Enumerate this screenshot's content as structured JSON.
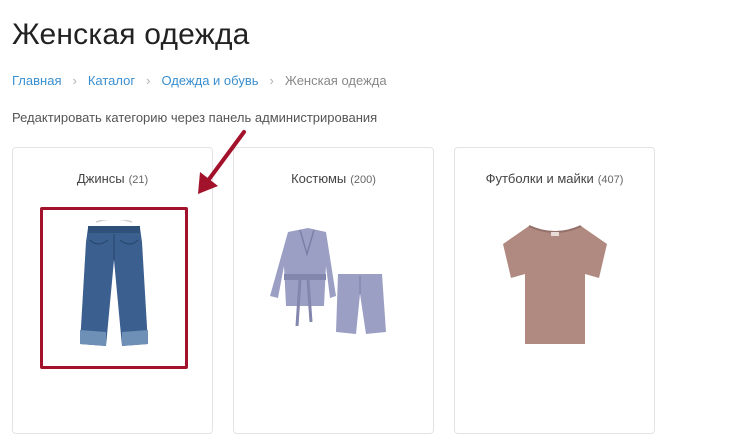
{
  "page": {
    "title": "Женская одежда"
  },
  "breadcrumb": [
    {
      "label": "Главная",
      "link": true
    },
    {
      "label": "Каталог",
      "link": true
    },
    {
      "label": "Одежда и обувь",
      "link": true
    },
    {
      "label": "Женская одежда",
      "link": false
    }
  ],
  "admin": {
    "label": "Редактировать категорию через панель администрирования"
  },
  "categories": [
    {
      "name": "Джинсы",
      "count": "(21)",
      "image_icon": "jeans-icon",
      "highlighted": true
    },
    {
      "name": "Костюмы",
      "count": "(200)",
      "image_icon": "suit-icon",
      "highlighted": false
    },
    {
      "name": "Футболки и майки",
      "count": "(407)",
      "image_icon": "tshirt-icon",
      "highlighted": false
    }
  ],
  "colors": {
    "link": "#3a8fd0",
    "highlight": "#a3122b",
    "jeans": "#3b5f8f",
    "suit": "#9c9fc4",
    "tshirt": "#b08a80"
  }
}
